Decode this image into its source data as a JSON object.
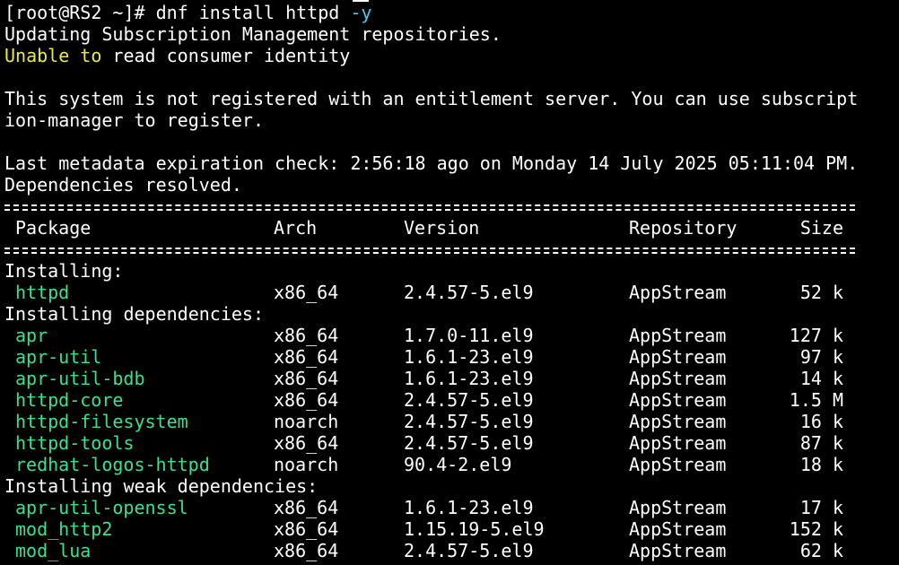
{
  "prompt": {
    "user_host": "[root@RS2 ~]#",
    "command": " dnf install httpd",
    "flag": " -y"
  },
  "messages": {
    "updating": "Updating Subscription Management repositories.",
    "unable_word1": "Unable",
    "unable_word2": " to",
    "unable_rest": " read consumer identity",
    "not_registered_1": "This system is not registered with an entitlement server. You can use subscript",
    "not_registered_2": "ion-manager to register.",
    "metadata": "Last metadata expiration check: 2:56:18 ago on Monday 14 July 2025 05:11:04 PM.",
    "deps_resolved": "Dependencies resolved."
  },
  "table": {
    "headers": {
      "package": "Package",
      "arch": "Arch",
      "version": "Version",
      "repository": "Repository",
      "size": "Size"
    },
    "groups": [
      {
        "label": "Installing:",
        "rows": [
          {
            "name": "httpd",
            "arch": "x86_64",
            "version": "2.4.57-5.el9",
            "repo": "AppStream",
            "size": "52 k"
          }
        ]
      },
      {
        "label": "Installing dependencies:",
        "rows": [
          {
            "name": "apr",
            "arch": "x86_64",
            "version": "1.7.0-11.el9",
            "repo": "AppStream",
            "size": "127 k"
          },
          {
            "name": "apr-util",
            "arch": "x86_64",
            "version": "1.6.1-23.el9",
            "repo": "AppStream",
            "size": "97 k"
          },
          {
            "name": "apr-util-bdb",
            "arch": "x86_64",
            "version": "1.6.1-23.el9",
            "repo": "AppStream",
            "size": "14 k"
          },
          {
            "name": "httpd-core",
            "arch": "x86_64",
            "version": "2.4.57-5.el9",
            "repo": "AppStream",
            "size": "1.5 M"
          },
          {
            "name": "httpd-filesystem",
            "arch": "noarch",
            "version": "2.4.57-5.el9",
            "repo": "AppStream",
            "size": "16 k"
          },
          {
            "name": "httpd-tools",
            "arch": "x86_64",
            "version": "2.4.57-5.el9",
            "repo": "AppStream",
            "size": "87 k"
          },
          {
            "name": "redhat-logos-httpd",
            "arch": "noarch",
            "version": "90.4-2.el9",
            "repo": "AppStream",
            "size": "18 k"
          }
        ]
      },
      {
        "label": "Installing weak dependencies:",
        "rows": [
          {
            "name": "apr-util-openssl",
            "arch": "x86_64",
            "version": "1.6.1-23.el9",
            "repo": "AppStream",
            "size": "17 k"
          },
          {
            "name": "mod_http2",
            "arch": "x86_64",
            "version": "1.15.19-5.el9",
            "repo": "AppStream",
            "size": "152 k"
          },
          {
            "name": "mod_lua",
            "arch": "x86_64",
            "version": "2.4.57-5.el9",
            "repo": "AppStream",
            "size": "62 k"
          }
        ]
      }
    ]
  },
  "colors": {
    "background": "#000000",
    "text": "#ffffff",
    "package_name": "#3be08a",
    "warning": "#e8e84a",
    "flag": "#4ec9e8"
  }
}
